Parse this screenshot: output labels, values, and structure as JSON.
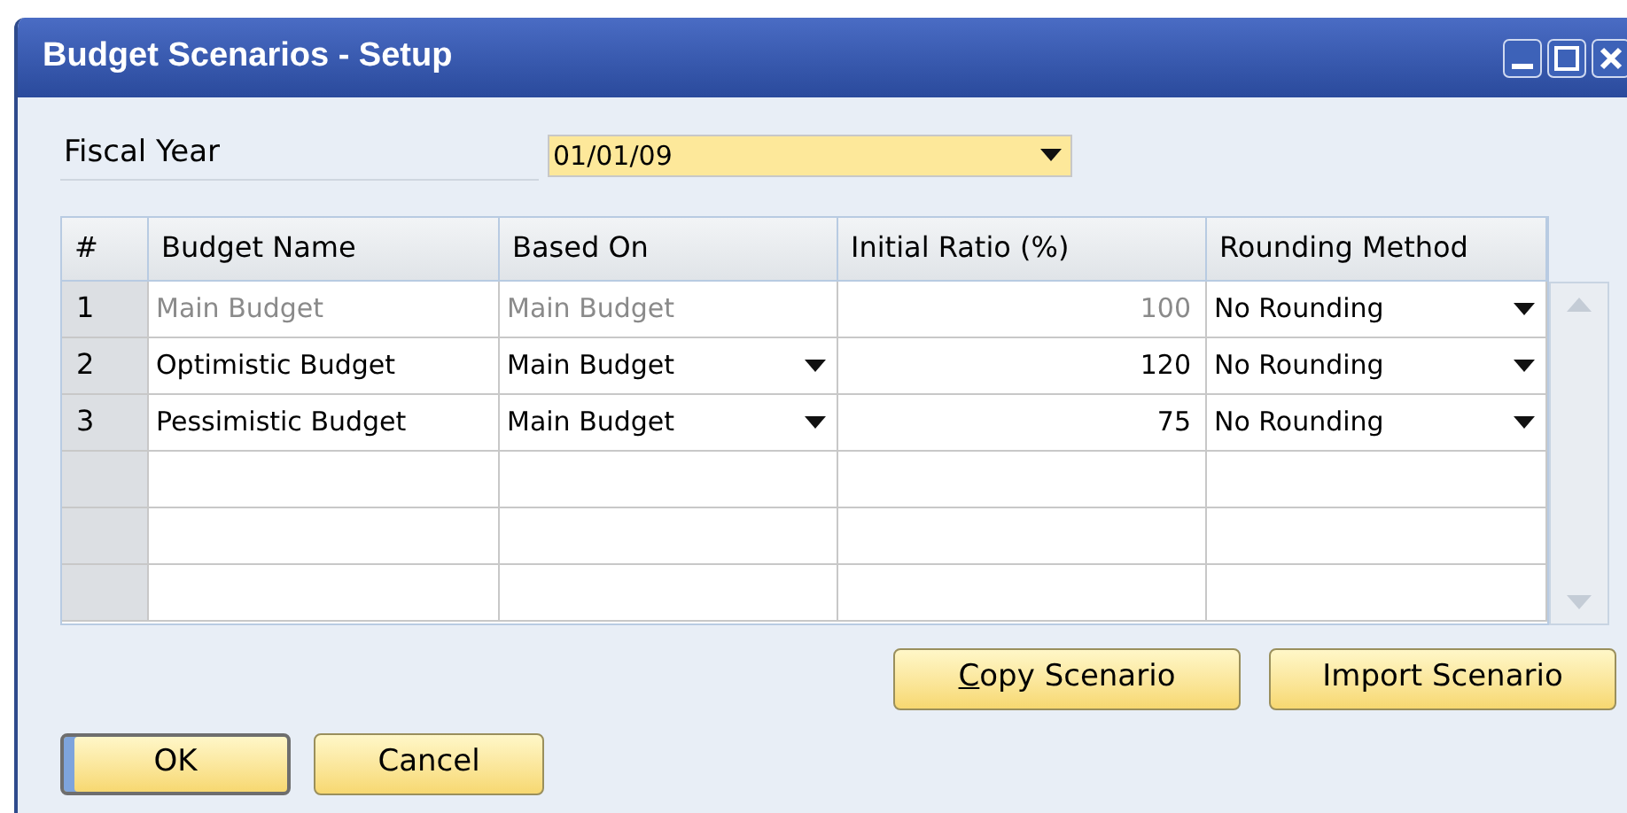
{
  "window": {
    "title": "Budget Scenarios - Setup"
  },
  "fiscal_year": {
    "label": "Fiscal Year",
    "value": "01/01/09"
  },
  "table": {
    "columns": [
      "#",
      "Budget Name",
      "Based On",
      "Initial Ratio (%)",
      "Rounding Method"
    ],
    "rows": [
      {
        "kind": "data",
        "number": "1",
        "budget_name": "Main Budget",
        "based_on": "Main Budget",
        "initial_ratio": "100",
        "rounding_method": "No Rounding",
        "disabled": true
      },
      {
        "kind": "data",
        "number": "2",
        "budget_name": "Optimistic Budget",
        "based_on": "Main Budget",
        "initial_ratio": "120",
        "rounding_method": "No Rounding",
        "disabled": false
      },
      {
        "kind": "data",
        "number": "3",
        "budget_name": "Pessimistic Budget",
        "based_on": "Main Budget",
        "initial_ratio": "75",
        "rounding_method": "No Rounding",
        "disabled": false
      },
      {
        "kind": "blank"
      },
      {
        "kind": "blank"
      },
      {
        "kind": "blank"
      }
    ]
  },
  "side_buttons": [
    {
      "label": "Copy Scenario",
      "mnemonic": true
    },
    {
      "label": "Import Scenario",
      "mnemonic": false
    }
  ],
  "buttons": [
    {
      "label": "OK",
      "default": true
    },
    {
      "label": "Cancel",
      "default": false
    }
  ]
}
